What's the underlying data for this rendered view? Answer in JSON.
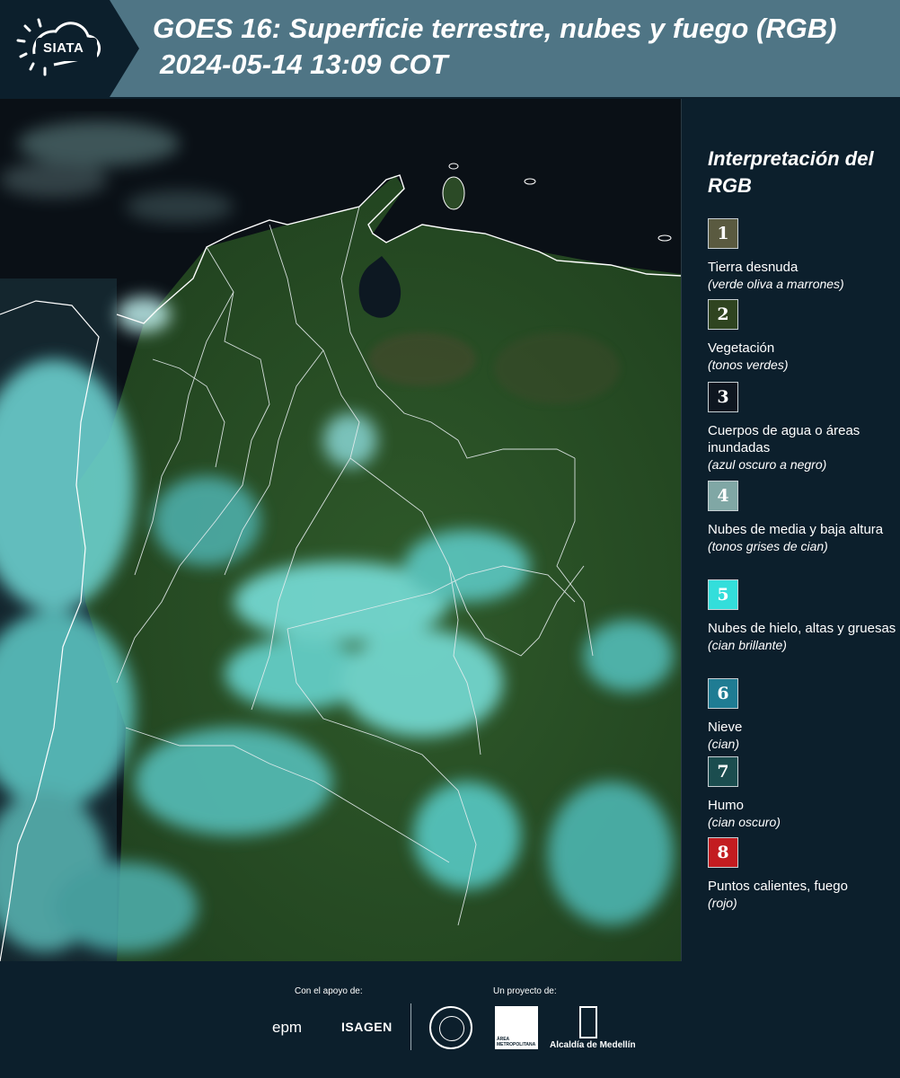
{
  "header": {
    "logo_text": "SIATA",
    "title_line1": "GOES 16: Superficie terrestre, nubes y fuego (RGB)",
    "title_line2": "2024-05-14 13:09 COT"
  },
  "legend": {
    "title": "Interpretación del RGB",
    "items": [
      {
        "number": "1",
        "label": "Tierra desnuda",
        "desc": "(verde oliva a marrones)",
        "color": "#5a5a40"
      },
      {
        "number": "2",
        "label": "Vegetación",
        "desc": "(tonos verdes)",
        "color": "#2f4420"
      },
      {
        "number": "3",
        "label": "Cuerpos de agua o áreas inundadas",
        "desc": "(azul oscuro a negro)",
        "color": "#0e1620"
      },
      {
        "number": "4",
        "label": "Nubes de media y baja altura",
        "desc": "(tonos grises de cian)",
        "color": "#80a7a5"
      },
      {
        "number": "5",
        "label": "Nubes de hielo, altas y gruesas",
        "desc": "(cian brillante)",
        "color": "#33dedb"
      },
      {
        "number": "6",
        "label": "Nieve",
        "desc": "(cian)",
        "color": "#1f7c93"
      },
      {
        "number": "7",
        "label": "Humo",
        "desc": "(cian oscuro)",
        "color": "#1b4d4f"
      },
      {
        "number": "8",
        "label": "Puntos calientes, fuego",
        "desc": "(rojo)",
        "color": "#c31c20"
      }
    ]
  },
  "footer": {
    "support_label": "Con el apoyo de:",
    "project_label": "Un proyecto de:",
    "epm": "epm",
    "isagen": "ISAGEN",
    "metro": "ÁREA METROPOLITANA",
    "alcaldia": "Alcaldía de Medellín"
  }
}
